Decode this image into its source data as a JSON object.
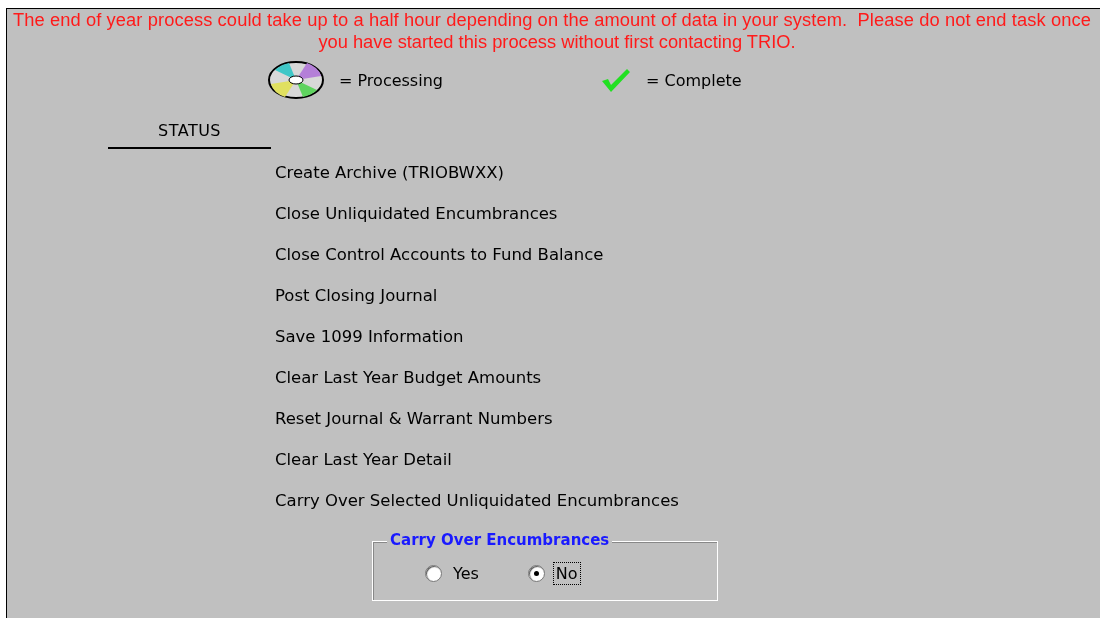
{
  "warning": [
    "The end of year process could take up to a half hour depending on the amount of data in your system.  Please do not end task once",
    "you have started this process without first contacting TRIO."
  ],
  "legend": [
    {
      "kind": "disc",
      "label": "= Processing"
    },
    {
      "kind": "check",
      "label": "= Complete"
    }
  ],
  "status_heading": "STATUS",
  "steps": [
    "Create Archive (TRIOBWXX)",
    "Close Unliquidated Encumbrances",
    "Close Control Accounts to Fund Balance",
    "Post Closing Journal",
    "Save 1099 Information",
    "Clear Last Year Budget Amounts",
    "Reset Journal & Warrant Numbers",
    "Clear Last Year Detail",
    "Carry Over Selected Unliquidated Encumbrances"
  ],
  "carry_over_group": {
    "title": "Carry Over Encumbrances",
    "options": [
      {
        "label": "Yes",
        "selected": false,
        "focused": false
      },
      {
        "label": "No",
        "selected": true,
        "focused": true
      }
    ]
  }
}
